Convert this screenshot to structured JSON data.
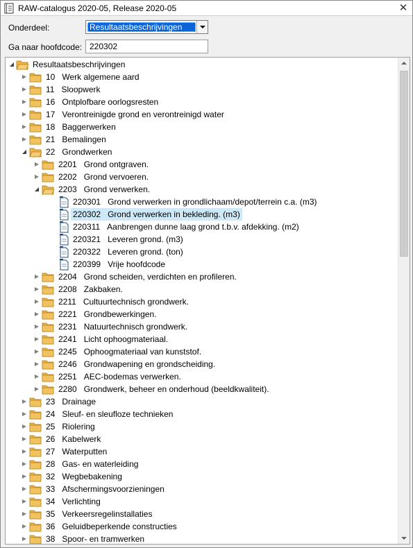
{
  "window": {
    "title": "RAW-catalogus 2020-05, Release 2020-05",
    "close_label": "✕"
  },
  "form": {
    "onderdeel_label": "Onderdeel:",
    "onderdeel_value": "Resultaatsbeschrijvingen",
    "hoofdcode_label": "Ga naar hoofdcode:",
    "hoofdcode_value": "220302"
  },
  "tree": {
    "root": "Resultaatsbeschrijvingen",
    "items": [
      {
        "code": "10",
        "text": "Werk algemene aard"
      },
      {
        "code": "11",
        "text": "Sloopwerk"
      },
      {
        "code": "16",
        "text": "Ontplofbare oorlogsresten"
      },
      {
        "code": "17",
        "text": "Verontreinigde grond en verontreinigd water"
      },
      {
        "code": "18",
        "text": "Baggerwerken"
      },
      {
        "code": "21",
        "text": "Bemalingen"
      },
      {
        "code": "22",
        "text": "Grondwerken"
      },
      {
        "code": "2201",
        "text": "Grond ontgraven."
      },
      {
        "code": "2202",
        "text": "Grond vervoeren."
      },
      {
        "code": "2203",
        "text": "Grond verwerken."
      },
      {
        "code": "220301",
        "text": "Grond verwerken in grondlichaam/depot/terrein c.a. (m3)"
      },
      {
        "code": "220302",
        "text": "Grond verwerken in bekleding. (m3)"
      },
      {
        "code": "220311",
        "text": "Aanbrengen dunne laag grond t.b.v. afdekking. (m2)"
      },
      {
        "code": "220321",
        "text": "Leveren grond. (m3)"
      },
      {
        "code": "220322",
        "text": "Leveren grond. (ton)"
      },
      {
        "code": "220399",
        "text": "Vrije hoofdcode"
      },
      {
        "code": "2204",
        "text": "Grond scheiden, verdichten en profileren."
      },
      {
        "code": "2208",
        "text": "Zakbaken."
      },
      {
        "code": "2211",
        "text": "Cultuurtechnisch grondwerk."
      },
      {
        "code": "2221",
        "text": "Grondbewerkingen."
      },
      {
        "code": "2231",
        "text": "Natuurtechnisch grondwerk."
      },
      {
        "code": "2241",
        "text": "Licht ophoogmateriaal."
      },
      {
        "code": "2245",
        "text": "Ophoogmateriaal van kunststof."
      },
      {
        "code": "2246",
        "text": "Grondwapening en grondscheiding."
      },
      {
        "code": "2251",
        "text": "AEC-bodemas verwerken."
      },
      {
        "code": "2280",
        "text": "Grondwerk, beheer en onderhoud (beeldkwaliteit)."
      },
      {
        "code": "23",
        "text": "Drainage"
      },
      {
        "code": "24",
        "text": "Sleuf- en sleufloze technieken"
      },
      {
        "code": "25",
        "text": "Riolering"
      },
      {
        "code": "26",
        "text": "Kabelwerk"
      },
      {
        "code": "27",
        "text": "Waterputten"
      },
      {
        "code": "28",
        "text": "Gas- en waterleiding"
      },
      {
        "code": "32",
        "text": "Wegbebakening"
      },
      {
        "code": "33",
        "text": "Afschermingsvoorzieningen"
      },
      {
        "code": "34",
        "text": "Verlichting"
      },
      {
        "code": "35",
        "text": "Verkeersregelinstallaties"
      },
      {
        "code": "36",
        "text": "Geluidbeperkende constructies"
      },
      {
        "code": "38",
        "text": "Spoor- en tramwerken"
      }
    ]
  },
  "icons": {
    "folder_color": "#e8b450",
    "document_color": "#1f4e79",
    "selection_color": "#cde8f7"
  }
}
